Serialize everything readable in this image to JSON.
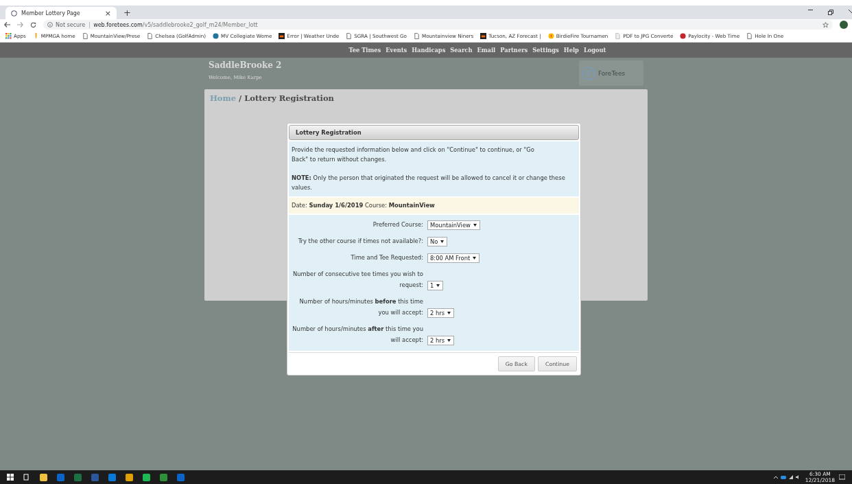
{
  "browser": {
    "tab_title": "Member Lottery Page",
    "tab_close": "×",
    "new_tab": "+",
    "security": "Not secure",
    "url_host": "web.foretees.com",
    "url_path": "/v5/saddlebrooke2_golf_m24/Member_lott",
    "bookmarks": [
      {
        "label": "Apps",
        "kind": "apps"
      },
      {
        "label": "MPMGA home",
        "kind": "pin"
      },
      {
        "label": "MountainView/Prese",
        "kind": "page"
      },
      {
        "label": "Chelsea (GolfAdmin)",
        "kind": "page"
      },
      {
        "label": "MV Collegiate Wome",
        "kind": "wp"
      },
      {
        "label": "Error | Weather Unde",
        "kind": "weather"
      },
      {
        "label": "SGRA | Southwest Go",
        "kind": "page"
      },
      {
        "label": "Mountainview Niners",
        "kind": "page"
      },
      {
        "label": "Tucson, AZ Forecast |",
        "kind": "weather"
      },
      {
        "label": "BirdieFire Tournamen",
        "kind": "fire"
      },
      {
        "label": "PDF to JPG Converte",
        "kind": "doc"
      },
      {
        "label": "Paylocity - Web Time",
        "kind": "ball"
      },
      {
        "label": "Hole In One",
        "kind": "page"
      }
    ]
  },
  "nav": [
    "Tee Times",
    "Events",
    "Handicaps",
    "Search",
    "Email",
    "Partners",
    "Settings",
    "Help",
    "Logout"
  ],
  "site": {
    "title": "SaddleBrooke 2",
    "welcome": "Welcome,  Mike Karpe",
    "logo_text": "ForeTees"
  },
  "breadcrumb": {
    "home": "Home",
    "separator": "/",
    "current": "Lottery Registration"
  },
  "dialog": {
    "title": "Lottery Registration",
    "intro": "Provide the requested information below and click on \"Continue\" to continue, or \"Go Back\" to return without changes.",
    "note": "**NOTE:** Only the person that originated the request will be allowed to cancel it or change these values.",
    "date_line": "Date: **Sunday 1/6/2019** Course: **MountainView**",
    "fields": [
      {
        "label": "Preferred Course:",
        "value": "MountainView"
      },
      {
        "label": "Try the other course if times not available?:",
        "value": "No"
      },
      {
        "label": "Time and Tee Requested:",
        "value": "8:00 AM Front"
      },
      {
        "label": "Number of consecutive tee times you wish to request:",
        "value": "1"
      },
      {
        "label": "Number of hours/minutes **before** this time you will accept:",
        "value": "2 hrs"
      },
      {
        "label": "Number of hours/minutes **after** this time you will accept:",
        "value": "2 hrs"
      }
    ],
    "buttons": [
      "Go Back",
      "Continue"
    ]
  },
  "taskbar": {
    "time": "6:30 AM",
    "date": "12/21/2018"
  }
}
